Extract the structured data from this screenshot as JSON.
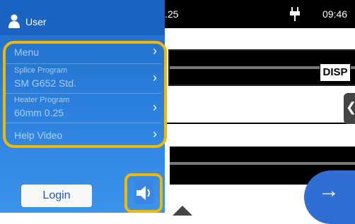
{
  "topbar": {
    "program_fragment": ".25",
    "time": "09:46",
    "icons": {
      "power": "plug-icon"
    }
  },
  "display": {
    "disp_label": "DISP",
    "side_tab_icon": "chevron-left-icon",
    "next_icon": "arrow-right-icon",
    "bottom_icon": "triangle-up-icon"
  },
  "panel": {
    "user_label": "User",
    "items": [
      {
        "label": "Menu"
      },
      {
        "title": "Splice Program",
        "value": "SM G652 Std."
      },
      {
        "title": "Heater Program",
        "value": "60mm 0.25"
      },
      {
        "label": "Help Video"
      }
    ],
    "login_label": "Login",
    "sound_icon": "speaker-icon",
    "accent": "#f0b800",
    "panel_color": "#2d82df"
  }
}
